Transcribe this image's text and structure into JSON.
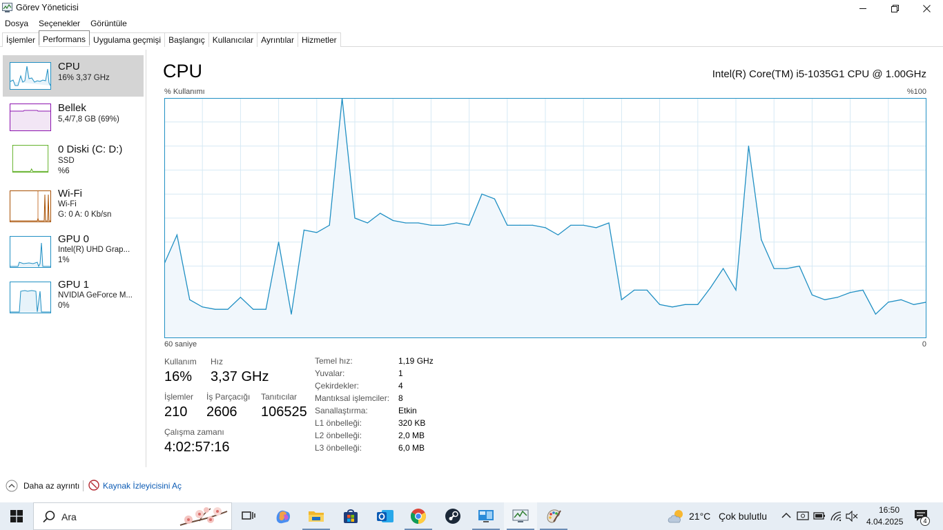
{
  "window": {
    "title": "Görev Yöneticisi"
  },
  "menu": {
    "items": [
      "Dosya",
      "Seçenekler",
      "Görüntüle"
    ]
  },
  "tabs": {
    "items": [
      "İşlemler",
      "Performans",
      "Uygulama geçmişi",
      "Başlangıç",
      "Kullanıcılar",
      "Ayrıntılar",
      "Hizmetler"
    ],
    "active": "Performans"
  },
  "sidebar": {
    "items": [
      {
        "title": "CPU",
        "sub1": "16% 3,37 GHz",
        "sub2": "",
        "color": "#1f8fc3",
        "selected": true
      },
      {
        "title": "Bellek",
        "sub1": "5,4/7,8 GB (69%)",
        "sub2": "",
        "color": "#8b12ae"
      },
      {
        "title": "0 Diski (C: D:)",
        "sub1": "SSD",
        "sub2": "%6",
        "color": "#4da60c"
      },
      {
        "title": "Wi-Fi",
        "sub1": "Wi-Fi",
        "sub2": "G: 0 A: 0 Kb/sn",
        "color": "#a74f01"
      },
      {
        "title": "GPU 0",
        "sub1": "Intel(R) UHD Grap...",
        "sub2": "1%",
        "color": "#1f8fc3"
      },
      {
        "title": "GPU 1",
        "sub1": "NVIDIA GeForce M...",
        "sub2": "0%",
        "color": "#1f8fc3"
      }
    ]
  },
  "main": {
    "title": "CPU",
    "model": "Intel(R) Core(TM) i5-1035G1 CPU @ 1.00GHz",
    "graph_ylabel": "% Kullanımı",
    "graph_ymax_label": "%100",
    "graph_xlabel": "60 saniye",
    "graph_xmin_label": "0",
    "line_color": "#1f8fc3"
  },
  "chart_data": {
    "type": "area",
    "title": "",
    "xlabel": "60 saniye",
    "ylabel": "% Kullanımı",
    "xlim": [
      60,
      0
    ],
    "ylim": [
      0,
      100
    ],
    "grid": true,
    "x": [
      60,
      59,
      58,
      57,
      56,
      55,
      54,
      53,
      52,
      51,
      50,
      49,
      48,
      47,
      46,
      45,
      44,
      43,
      42,
      41,
      40,
      39,
      38,
      37,
      36,
      35,
      34,
      33,
      32,
      31,
      30,
      29,
      28,
      27,
      26,
      25,
      24,
      23,
      22,
      21,
      20,
      19,
      18,
      17,
      16,
      15,
      14,
      13,
      12,
      11,
      10,
      9,
      8,
      7,
      6,
      5,
      4,
      3,
      2,
      1,
      0
    ],
    "series": [
      {
        "values": [
          31,
          43,
          16,
          13,
          12,
          12,
          17,
          12,
          12,
          40,
          10,
          45,
          44,
          47,
          100,
          50,
          48,
          52,
          49,
          48,
          48,
          47,
          47,
          48,
          47,
          60,
          58,
          47,
          47,
          47,
          46,
          43,
          47,
          47,
          46,
          48,
          16,
          20,
          20,
          14,
          13,
          14,
          14,
          21,
          29,
          20,
          80,
          41,
          29,
          29,
          30,
          18,
          16,
          17,
          19,
          20,
          10,
          15,
          16,
          14,
          15
        ]
      }
    ]
  },
  "stats": {
    "usage_label": "Kullanım",
    "usage_value": "16%",
    "speed_label": "Hız",
    "speed_value": "3,37 GHz",
    "processes_label": "İşlemler",
    "processes_value": "210",
    "threads_label": "İş Parçacığı",
    "threads_value": "2606",
    "handles_label": "Tanıtıcılar",
    "handles_value": "106525",
    "uptime_label": "Çalışma zamanı",
    "uptime_value": "4:02:57:16"
  },
  "details": {
    "items": [
      {
        "label": "Temel hız:",
        "value": "1,19 GHz"
      },
      {
        "label": "Yuvalar:",
        "value": "1"
      },
      {
        "label": "Çekirdekler:",
        "value": "4"
      },
      {
        "label": "Mantıksal işlemciler:",
        "value": "8"
      },
      {
        "label": "Sanallaştırma:",
        "value": "Etkin"
      },
      {
        "label": "L1 önbelleği:",
        "value": "320 KB"
      },
      {
        "label": "L2 önbelleği:",
        "value": "2,0 MB"
      },
      {
        "label": "L3 önbelleği:",
        "value": "6,0 MB"
      }
    ]
  },
  "footer": {
    "fewer_details": "Daha az ayrıntı",
    "resource_monitor": "Kaynak İzleyicisini Aç"
  },
  "taskbar": {
    "search_placeholder": "Ara",
    "weather_temp": "21°C",
    "weather_desc": "Çok bulutlu",
    "time": "16:50",
    "date": "4.04.2025",
    "notifications": "4"
  }
}
